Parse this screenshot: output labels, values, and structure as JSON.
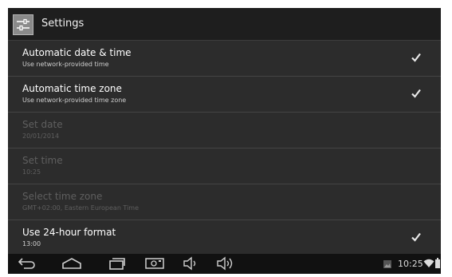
{
  "actionbar": {
    "title": "Settings",
    "icon": "settings-sliders-icon"
  },
  "settings": [
    {
      "title": "Automatic date & time",
      "summary": "Use network-provided time",
      "enabled": true,
      "checked": true
    },
    {
      "title": "Automatic time zone",
      "summary": "Use network-provided time zone",
      "enabled": true,
      "checked": true
    },
    {
      "title": "Set date",
      "summary": "20/01/2014",
      "enabled": false
    },
    {
      "title": "Set time",
      "summary": "10:25",
      "enabled": false
    },
    {
      "title": "Select time zone",
      "summary": "GMT+02:00, Eastern European Time",
      "enabled": false
    },
    {
      "title": "Use 24-hour format",
      "summary": "13:00",
      "enabled": true,
      "checked": true
    }
  ],
  "statusbar": {
    "time": "10:25",
    "icons": [
      "back-icon",
      "home-icon",
      "recent-apps-icon",
      "screenshot-icon",
      "volume-down-icon",
      "volume-up-icon",
      "gallery-notification-icon",
      "wifi-icon",
      "battery-icon"
    ]
  },
  "colors": {
    "background": "#2c2c2c",
    "actionbar": "#1e1e1e",
    "navbar": "#111111",
    "text": "#ffffff",
    "disabled_text": "#5f5f5f"
  }
}
